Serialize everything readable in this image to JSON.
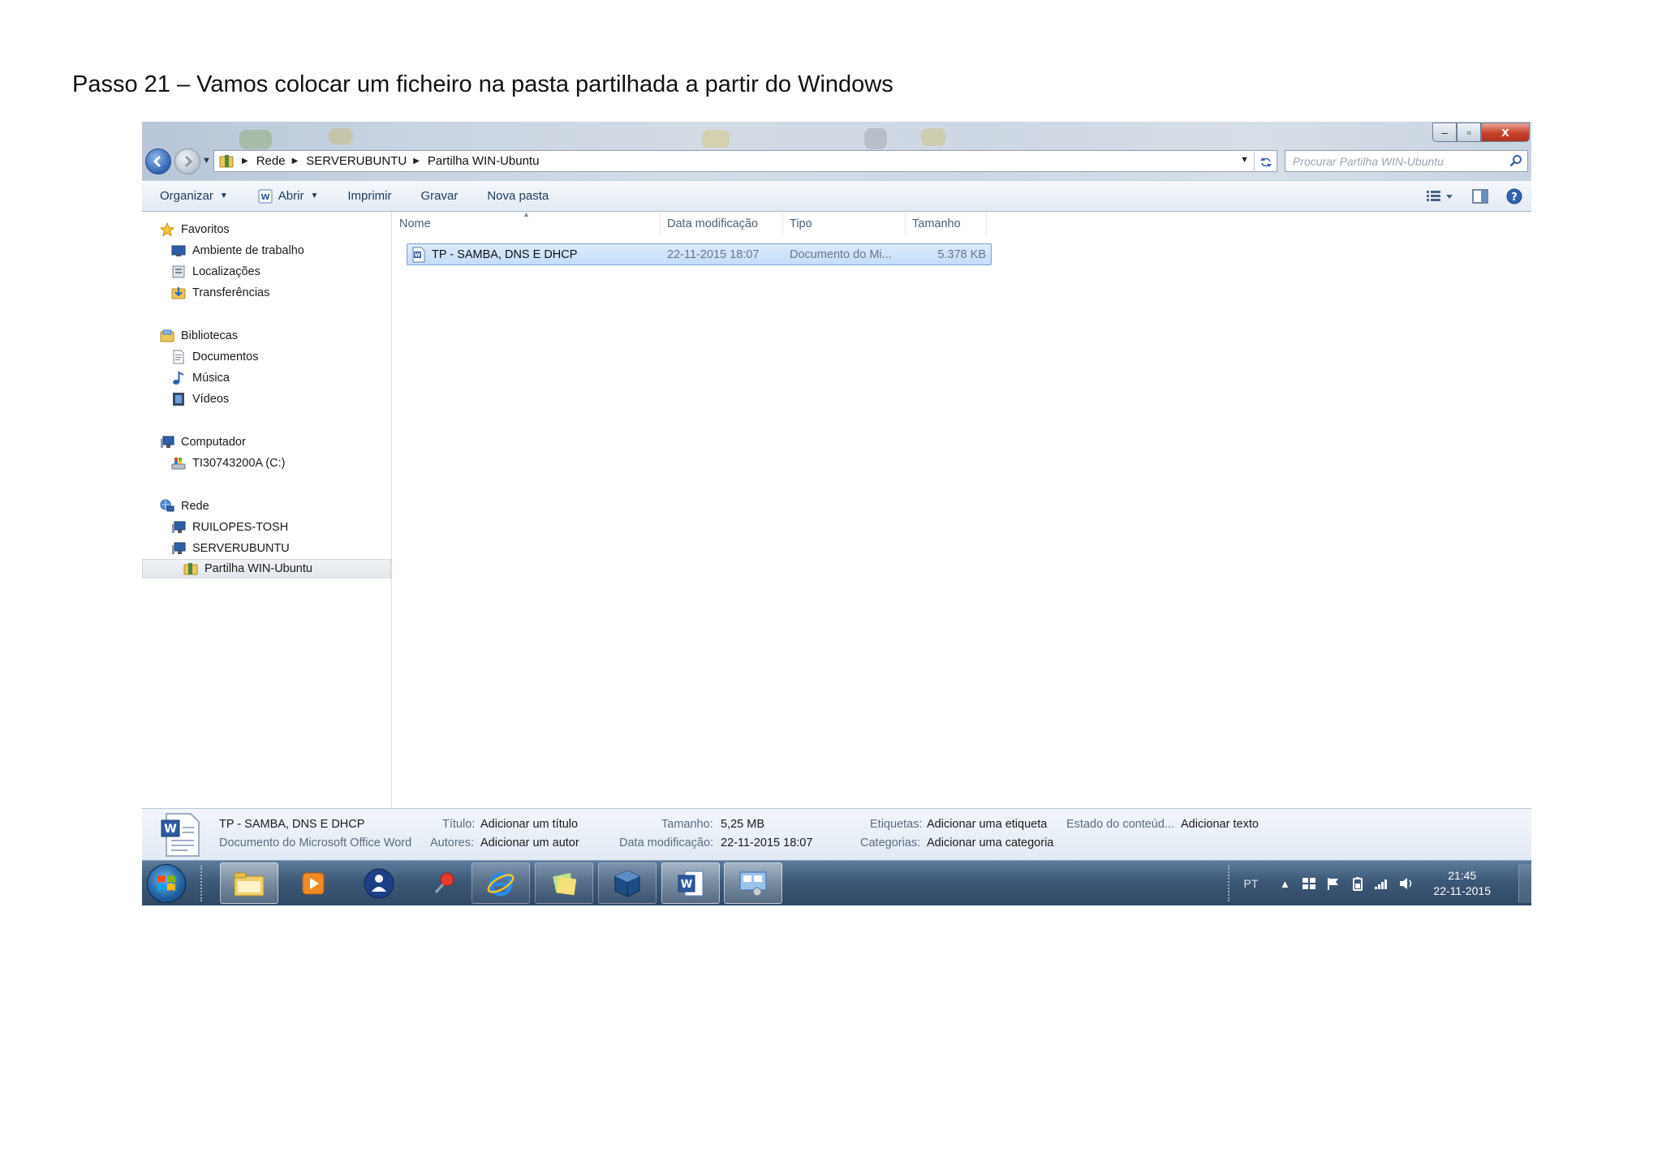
{
  "page": {
    "heading": "Passo 21 – Vamos colocar um ficheiro na pasta partilhada a partir do Windows"
  },
  "window": {
    "controls": {
      "minimize": "–",
      "maximize": "▫",
      "close": "x"
    },
    "address": {
      "segments": [
        "Rede",
        "SERVERUBUNTU",
        "Partilha WIN-Ubuntu"
      ]
    },
    "search": {
      "placeholder": "Procurar Partilha WIN-Ubuntu"
    },
    "toolbar": {
      "organize": "Organizar",
      "open": "Abrir",
      "print": "Imprimir",
      "burn": "Gravar",
      "new_folder": "Nova pasta"
    },
    "nav": {
      "favorites": "Favoritos",
      "desktop": "Ambiente de trabalho",
      "locations": "Localizações",
      "downloads": "Transferências",
      "libraries": "Bibliotecas",
      "documents": "Documentos",
      "music": "Música",
      "videos": "Vídeos",
      "computer": "Computador",
      "drive_c": "TI30743200A (C:)",
      "network": "Rede",
      "pc1": "RUILOPES-TOSH",
      "pc2": "SERVERUBUNTU",
      "share": "Partilha WIN-Ubuntu"
    },
    "columns": {
      "name": "Nome",
      "modified": "Data modificação",
      "type": "Tipo",
      "size": "Tamanho"
    },
    "files": [
      {
        "name": "TP - SAMBA, DNS E DHCP",
        "modified": "22-11-2015 18:07",
        "type": "Documento do Mi...",
        "size": "5.378 KB"
      }
    ],
    "details": {
      "file_name": "TP - SAMBA, DNS E DHCP",
      "file_type": "Documento do Microsoft Office Word",
      "title_label": "Título:",
      "title_value": "Adicionar um título",
      "authors_label": "Autores:",
      "authors_value": "Adicionar um autor",
      "size_label": "Tamanho:",
      "size_value": "5,25 MB",
      "modified_label": "Data modificação:",
      "modified_value": "22-11-2015 18:07",
      "tags_label": "Etiquetas:",
      "tags_value": "Adicionar uma etiqueta",
      "categories_label": "Categorias:",
      "categories_value": "Adicionar uma categoria",
      "status_label": "Estado do conteúd...",
      "status_value": "Adicionar texto"
    }
  },
  "taskbar": {
    "language": "PT",
    "clock_time": "21:45",
    "clock_date": "22-11-2015"
  }
}
